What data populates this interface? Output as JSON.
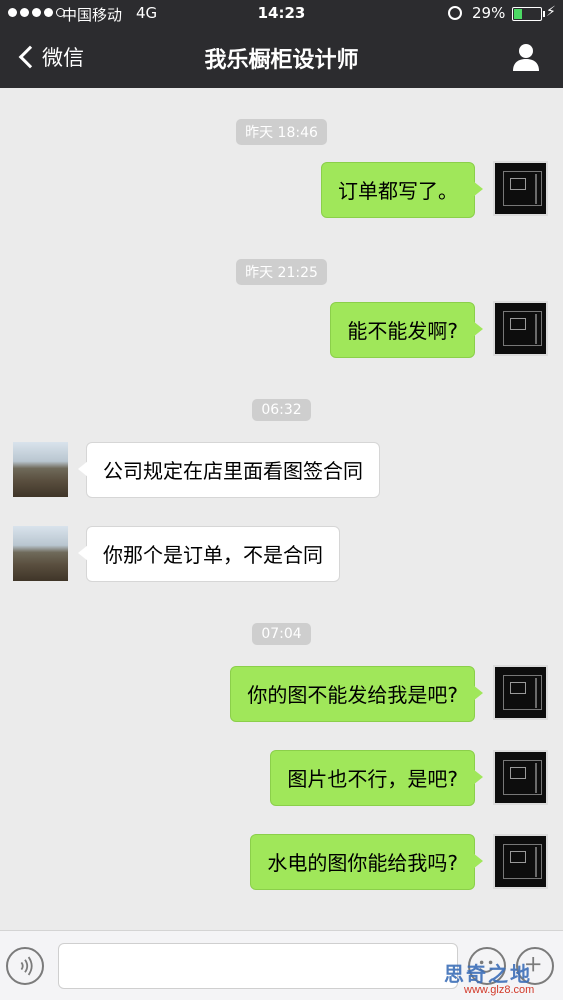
{
  "status_bar": {
    "carrier": "中国移动",
    "network": "4G",
    "time": "14:23",
    "battery_percent": "29%",
    "battery_level": 0.29,
    "signal_bars_filled": 4,
    "signal_bars_total": 5,
    "icons": [
      "signal-dots",
      "alarm-clock-icon",
      "battery-icon",
      "charging-bolt-icon"
    ]
  },
  "nav": {
    "back_label": "微信",
    "title": "我乐橱柜设计师",
    "right_icon": "profile-icon"
  },
  "messages": [
    {
      "type": "timestamp",
      "text": "昨天 18:46"
    },
    {
      "type": "sent",
      "text": "订单都写了。"
    },
    {
      "type": "timestamp",
      "text": "昨天 21:25"
    },
    {
      "type": "sent",
      "text": "能不能发啊?"
    },
    {
      "type": "timestamp",
      "text": "06:32"
    },
    {
      "type": "received",
      "text": "公司规定在店里面看图签合同"
    },
    {
      "type": "received",
      "text": "你那个是订单，不是合同"
    },
    {
      "type": "timestamp",
      "text": "07:04"
    },
    {
      "type": "sent",
      "text": "你的图不能发给我是吧?"
    },
    {
      "type": "sent",
      "text": "图片也不行，是吧?"
    },
    {
      "type": "sent",
      "text": "水电的图你能给我吗?"
    }
  ],
  "input_bar": {
    "text_value": "",
    "left_icon": "voice-icon",
    "right_icons": [
      "emoji-icon",
      "plus-icon"
    ]
  },
  "watermark": {
    "logo_text": "思奇之地",
    "url": "www.glz8.com"
  },
  "colors": {
    "nav_bg": "#2c2c2f",
    "chat_bg": "#ebebeb",
    "sent_bubble": "#a0e75a",
    "received_bubble": "#ffffff",
    "timestamp_bg": "#cecece",
    "battery_fill": "#4cd964"
  }
}
